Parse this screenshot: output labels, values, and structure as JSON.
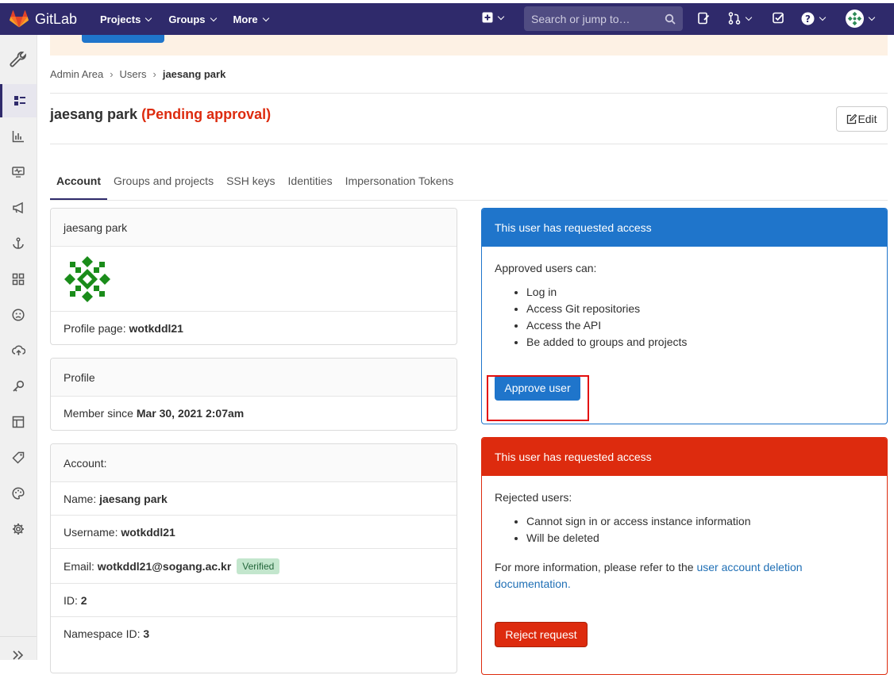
{
  "topbar": {
    "logo_text": "GitLab",
    "nav": [
      "Projects",
      "Groups",
      "More"
    ],
    "search_placeholder": "Search or jump to…",
    "icons": [
      "plus-square-icon",
      "todo-icon",
      "merge-request-icon",
      "issues-check-icon",
      "help-icon",
      "avatar-icon"
    ]
  },
  "sidebar": {
    "items": [
      "admin-wrench-icon",
      "overview-icon",
      "analytics-icon",
      "monitoring-icon",
      "messages-icon",
      "system-hooks-icon",
      "applications-icon",
      "abuse-reports-icon",
      "deploy-keys-icon",
      "credentials-icon",
      "templates-icon",
      "labels-icon",
      "appearance-icon",
      "settings-icon",
      "collapse-icon"
    ]
  },
  "breadcrumb": {
    "items": [
      "Admin Area",
      "Users",
      "jaesang park"
    ]
  },
  "header": {
    "name": "jaesang park",
    "status": "(Pending approval)",
    "edit_label": "Edit"
  },
  "tabs": [
    {
      "label": "Account",
      "active": true
    },
    {
      "label": "Groups and projects",
      "active": false
    },
    {
      "label": "SSH keys",
      "active": false
    },
    {
      "label": "Identities",
      "active": false
    },
    {
      "label": "Impersonation Tokens",
      "active": false
    }
  ],
  "user_card": {
    "name": "jaesang park",
    "profile_label": "Profile page:",
    "profile_value": "wotkddl21"
  },
  "profile_card": {
    "header": "Profile",
    "member_label": "Member since",
    "member_value": "Mar 30, 2021 2:07am"
  },
  "account_card": {
    "header": "Account:",
    "name_label": "Name:",
    "name_value": "jaesang park",
    "username_label": "Username:",
    "username_value": "wotkddl21",
    "email_label": "Email:",
    "email_value": "wotkddl21@sogang.ac.kr",
    "email_badge": "Verified",
    "id_label": "ID:",
    "id_value": "2",
    "namespace_label": "Namespace ID:",
    "namespace_value": "3"
  },
  "approve_card": {
    "header": "This user has requested access",
    "intro": "Approved users can:",
    "items": [
      "Log in",
      "Access Git repositories",
      "Access the API",
      "Be added to groups and projects"
    ],
    "button": "Approve user",
    "header_color": "#1f75cb"
  },
  "reject_card": {
    "header": "This user has requested access",
    "intro": "Rejected users:",
    "items": [
      "Cannot sign in or access instance information",
      "Will be deleted"
    ],
    "info_text": "For more information, please refer to the",
    "info_link": "user account deletion documentation.",
    "button": "Reject request",
    "header_color": "#dd2b0e"
  }
}
